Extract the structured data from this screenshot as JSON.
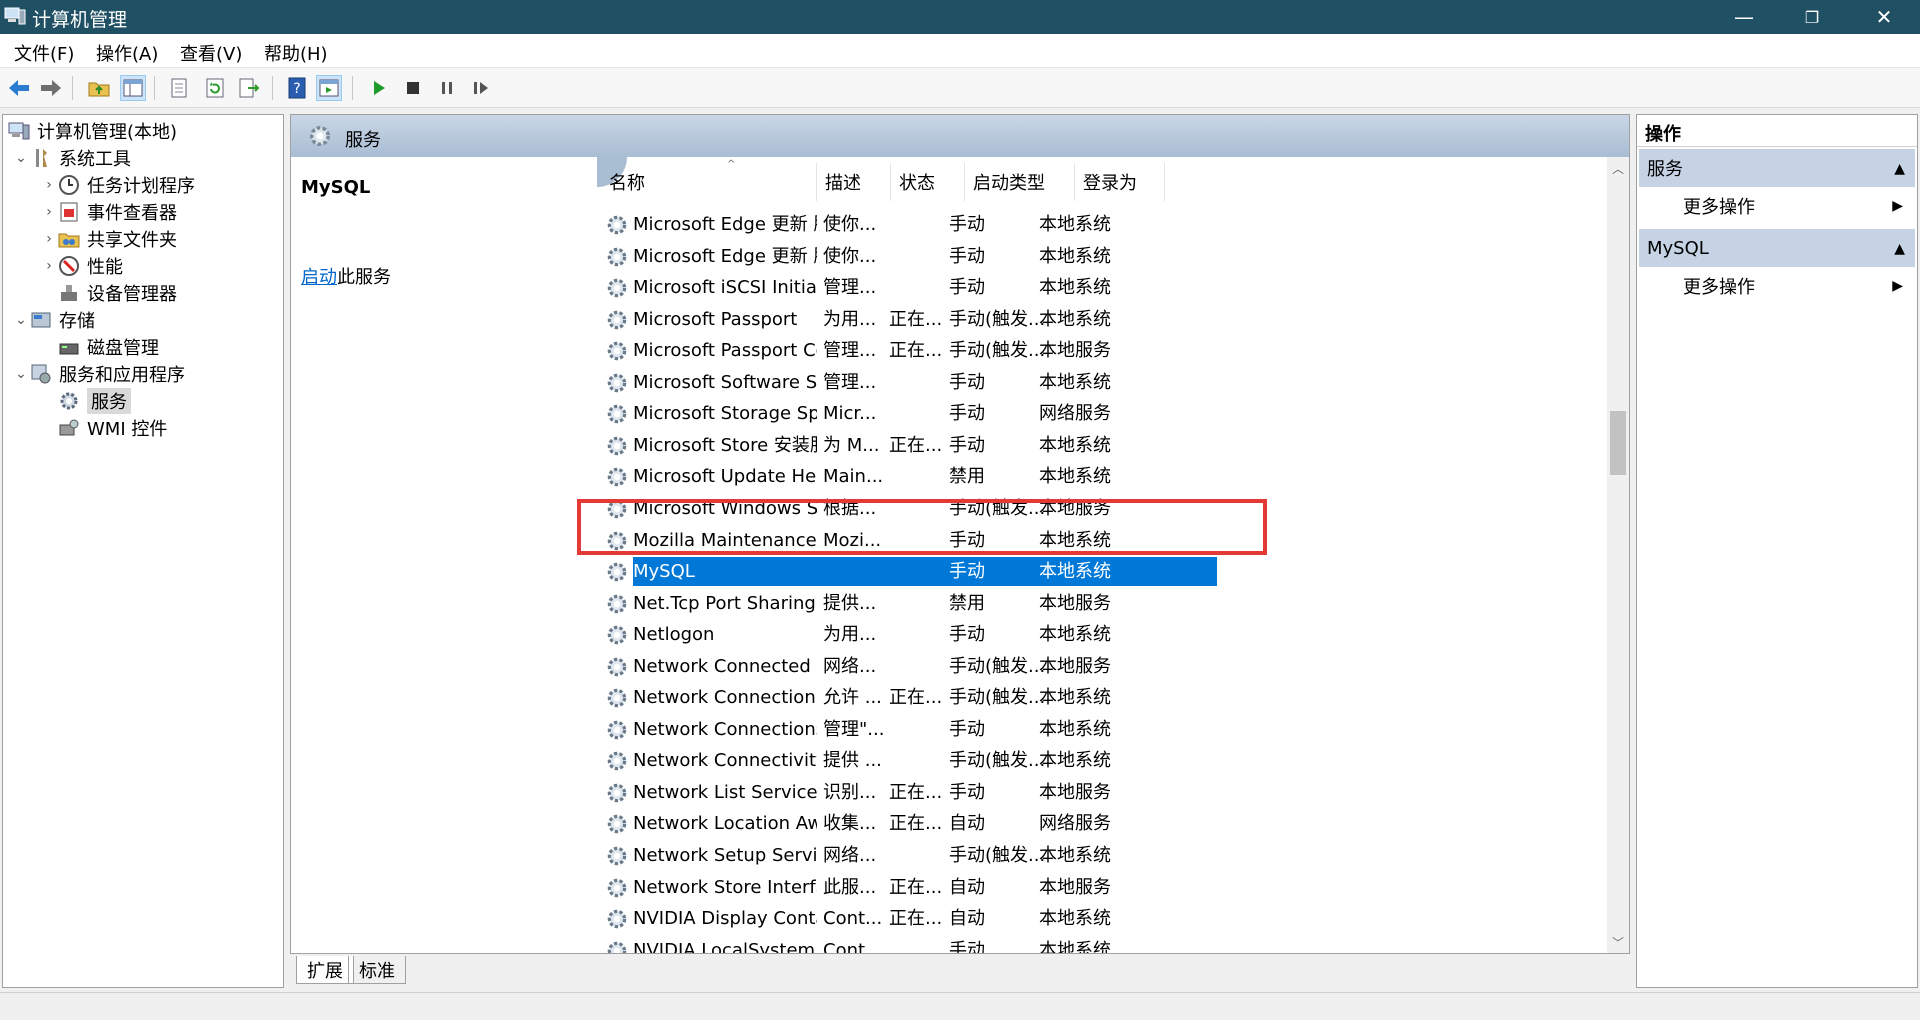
{
  "window": {
    "title": "计算机管理",
    "minimize": "—",
    "restore": "❐",
    "close": "✕"
  },
  "menu": [
    "文件(F)",
    "操作(A)",
    "查看(V)",
    "帮助(H)"
  ],
  "tree": {
    "root": "计算机管理(本地)",
    "system_tools": "系统工具",
    "task_scheduler": "任务计划程序",
    "event_viewer": "事件查看器",
    "shared_folders": "共享文件夹",
    "performance": "性能",
    "device_manager": "设备管理器",
    "storage": "存储",
    "disk_management": "磁盘管理",
    "services_apps": "服务和应用程序",
    "services": "服务",
    "wmi": "WMI 控件"
  },
  "center": {
    "header_title": "服务",
    "detail_name": "MySQL",
    "detail_link": "启动",
    "detail_suffix": "此服务"
  },
  "columns": [
    "名称",
    "描述",
    "状态",
    "启动类型",
    "登录为"
  ],
  "rows": [
    [
      "Microsoft Edge 更新 服务 (...",
      "使你...",
      "",
      "手动",
      "本地系统"
    ],
    [
      "Microsoft Edge 更新 服务 (...",
      "使你...",
      "",
      "手动",
      "本地系统"
    ],
    [
      "Microsoft iSCSI Initiator Ser...",
      "管理...",
      "",
      "手动",
      "本地系统"
    ],
    [
      "Microsoft Passport",
      "为用...",
      "正在...",
      "手动(触发...",
      "本地系统"
    ],
    [
      "Microsoft Passport Container",
      "管理...",
      "正在...",
      "手动(触发...",
      "本地服务"
    ],
    [
      "Microsoft Software Shado...",
      "管理...",
      "",
      "手动",
      "本地系统"
    ],
    [
      "Microsoft Storage Spaces S...",
      "Micr...",
      "",
      "手动",
      "网络服务"
    ],
    [
      "Microsoft Store 安装服务",
      "为 M...",
      "正在...",
      "手动",
      "本地系统"
    ],
    [
      "Microsoft Update Health S...",
      "Main...",
      "",
      "禁用",
      "本地系统"
    ],
    [
      "Microsoft Windows SMS 路...",
      "根据...",
      "",
      "手动(触发...",
      "本地服务"
    ],
    [
      "Mozilla Maintenance Service",
      "Mozi...",
      "",
      "手动",
      "本地系统"
    ],
    [
      "MySQL",
      "",
      "",
      "手动",
      "本地系统"
    ],
    [
      "Net.Tcp Port Sharing Service",
      "提供...",
      "",
      "禁用",
      "本地服务"
    ],
    [
      "Netlogon",
      "为用...",
      "",
      "手动",
      "本地系统"
    ],
    [
      "Network Connected Devic...",
      "网络...",
      "",
      "手动(触发...",
      "本地服务"
    ],
    [
      "Network Connection Broker",
      "允许 ...",
      "正在...",
      "手动(触发...",
      "本地系统"
    ],
    [
      "Network Connections",
      "管理\"...",
      "",
      "手动",
      "本地系统"
    ],
    [
      "Network Connectivity Assis...",
      "提供 ...",
      "",
      "手动(触发...",
      "本地系统"
    ],
    [
      "Network List Service",
      "识别...",
      "正在...",
      "手动",
      "本地服务"
    ],
    [
      "Network Location Awarene...",
      "收集...",
      "正在...",
      "自动",
      "网络服务"
    ],
    [
      "Network Setup Service",
      "网络...",
      "",
      "手动(触发...",
      "本地系统"
    ],
    [
      "Network Store Interface Se...",
      "此服...",
      "正在...",
      "自动",
      "本地服务"
    ],
    [
      "NVIDIA Display Container LS",
      "Cont...",
      "正在...",
      "自动",
      "本地系统"
    ],
    [
      "NVIDIA LocalSystem Conta...",
      "Cont...",
      "",
      "手动",
      "本地系统"
    ]
  ],
  "selected_row": 11,
  "tabs": [
    "扩展",
    "标准"
  ],
  "actions": {
    "title": "操作",
    "group1": "服务",
    "group1_more": "更多操作",
    "group2": "MySQL",
    "group2_more": "更多操作"
  },
  "colors": {
    "titlebar": "#1f5063",
    "selection": "#0078d7",
    "highlight_box": "#e53935",
    "link": "#0066cc"
  }
}
